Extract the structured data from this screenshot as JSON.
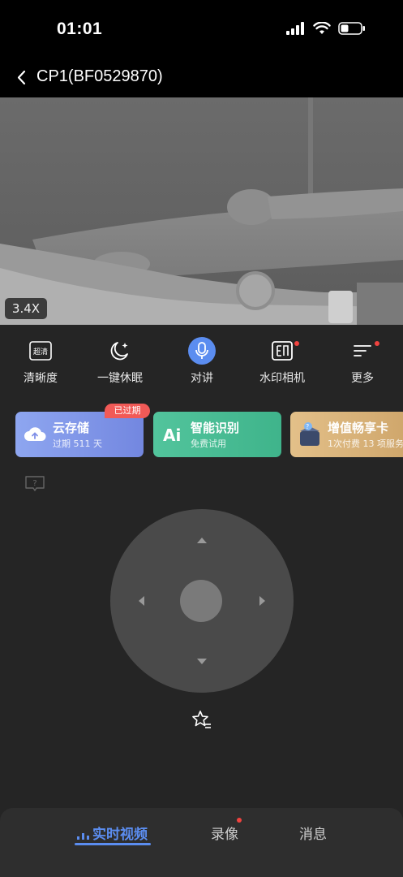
{
  "status_bar": {
    "time": "01:01"
  },
  "header": {
    "title": "CP1(BF0529870)"
  },
  "video": {
    "zoom_label": "3.4X"
  },
  "toolbar": {
    "items": [
      {
        "label": "清晰度",
        "icon": "hd-icon",
        "icon_text": "超清"
      },
      {
        "label": "一键休眠",
        "icon": "moon-sleep-icon"
      },
      {
        "label": "对讲",
        "icon": "microphone-icon"
      },
      {
        "label": "水印相机",
        "icon": "watermark-camera-icon"
      },
      {
        "label": "更多",
        "icon": "more-menu-icon"
      }
    ]
  },
  "cards": [
    {
      "title": "云存储",
      "subtitle": "过期 511 天",
      "badge": "已过期",
      "icon": "cloud-upload-icon",
      "color": "#7f8fe8"
    },
    {
      "title": "智能识别",
      "subtitle": "免费试用",
      "icon": "ai-icon",
      "color": "#48bf95"
    },
    {
      "title": "增值畅享卡",
      "subtitle": "1次付费 13 项服务",
      "icon": "gift-box-icon",
      "color": "#d9b27a"
    }
  ],
  "bottom_nav": {
    "tabs": [
      {
        "label": "实时视频",
        "active": true
      },
      {
        "label": "录像",
        "active": false
      },
      {
        "label": "消息",
        "active": false
      }
    ]
  },
  "colors": {
    "accent": "#5b8df0",
    "alert": "#f0433f",
    "background": "#252525"
  }
}
